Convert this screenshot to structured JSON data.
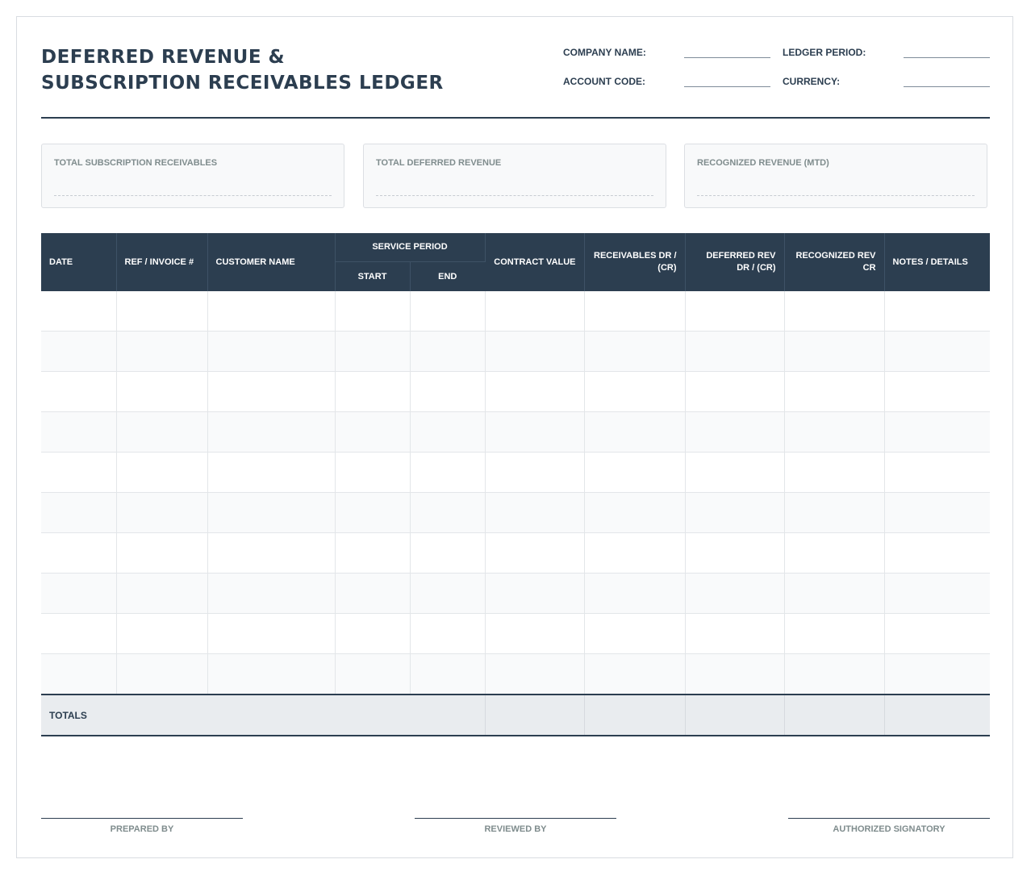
{
  "header": {
    "title_line1": "DEFERRED REVENUE &",
    "title_line2": "SUBSCRIPTION RECEIVABLES LEDGER",
    "fields": {
      "company_name": "COMPANY NAME:",
      "account_code": "ACCOUNT CODE:",
      "ledger_period": "LEDGER PERIOD:",
      "currency": "CURRENCY:"
    }
  },
  "summary": {
    "total_receivables": "TOTAL SUBSCRIPTION RECEIVABLES",
    "total_deferred": "TOTAL DEFERRED REVENUE",
    "recognized_mtd": "RECOGNIZED REVENUE (MTD)"
  },
  "table": {
    "columns": {
      "date": "DATE",
      "ref": "REF / INVOICE #",
      "customer": "CUSTOMER NAME",
      "service_period": "SERVICE PERIOD",
      "start": "START",
      "end": "END",
      "contract_value": "CONTRACT VALUE",
      "receivables": "RECEIVABLES DR / (CR)",
      "deferred": "DEFERRED REV DR / (CR)",
      "recognized": "RECOGNIZED REV CR",
      "notes": "NOTES / DETAILS"
    },
    "totals_label": "TOTALS"
  },
  "signatures": {
    "prepared": "PREPARED BY",
    "reviewed": "REVIEWED BY",
    "authorized": "AUTHORIZED SIGNATORY"
  },
  "colors": {
    "header_navy": "#2c3e50",
    "card_bg": "#f8f9fa",
    "totals_bg": "#e9ecef"
  }
}
